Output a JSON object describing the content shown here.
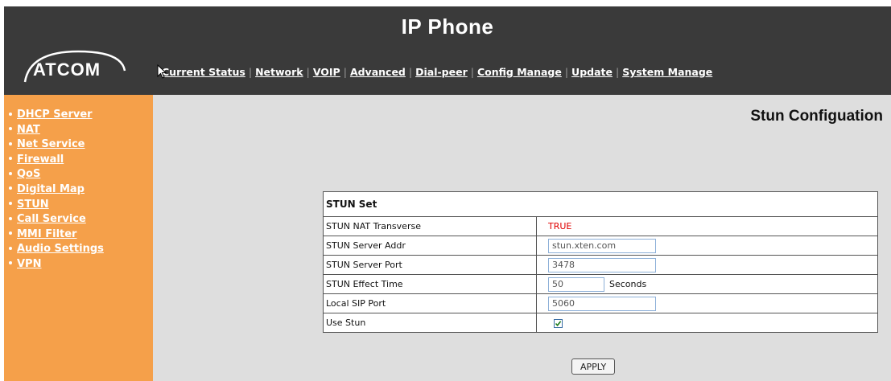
{
  "header": {
    "title": "IP Phone",
    "logo_text": "ATCOM",
    "nav": [
      "Current Status",
      "Network",
      "VOIP",
      "Advanced",
      "Dial-peer",
      "Config Manage",
      "Update",
      "System Manage"
    ]
  },
  "sidebar": {
    "items": [
      {
        "label": "DHCP Server"
      },
      {
        "label": "NAT"
      },
      {
        "label": "Net Service"
      },
      {
        "label": "Firewall"
      },
      {
        "label": "QoS"
      },
      {
        "label": "Digital Map"
      },
      {
        "label": "STUN"
      },
      {
        "label": "Call Service"
      },
      {
        "label": "MMI Filter"
      },
      {
        "label": "Audio Settings"
      },
      {
        "label": "VPN"
      }
    ]
  },
  "main": {
    "page_title": "Stun Configuation",
    "table": {
      "header": "STUN Set",
      "nat_label": "STUN NAT Transverse",
      "nat_value": "TRUE",
      "server_addr_label": "STUN Server Addr",
      "server_addr_value": "stun.xten.com",
      "server_port_label": "STUN Server Port",
      "server_port_value": "3478",
      "effect_time_label": "STUN Effect Time",
      "effect_time_value": "50",
      "effect_time_unit": "Seconds",
      "sip_port_label": "Local SIP Port",
      "sip_port_value": "5060",
      "use_stun_label": "Use Stun",
      "use_stun_checked": true
    },
    "apply_label": "APPLY"
  },
  "colors": {
    "header_bg": "#3a3a3a",
    "sidebar_bg": "#f5a04a",
    "main_bg": "#dedede",
    "true_text": "#e00000"
  }
}
